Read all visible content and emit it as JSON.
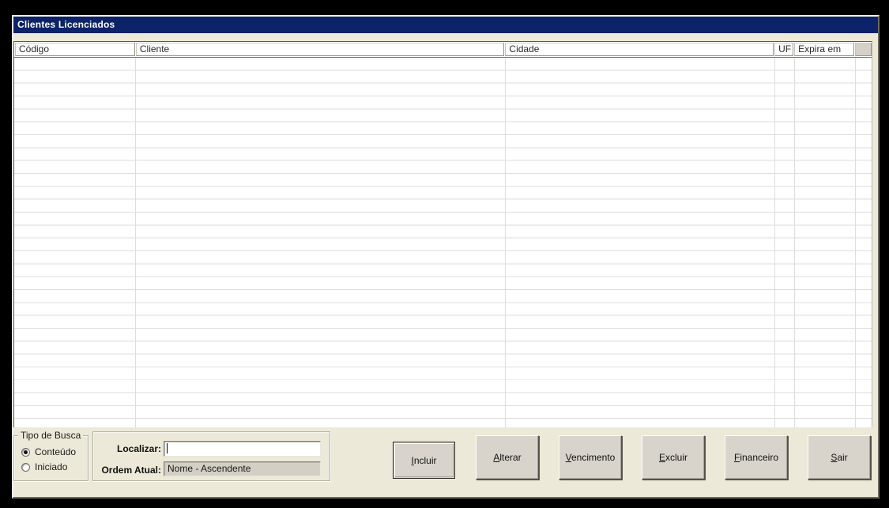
{
  "window": {
    "title": "Clientes Licenciados"
  },
  "colors": {
    "title_bar": "#0C2369",
    "window_background": "#ECE9D8",
    "button_face": "#D8D4CB",
    "grid_line": "#DEDEDC"
  },
  "table": {
    "columns": [
      "Código",
      "Cliente",
      "Cidade",
      "UF",
      "Expira em",
      ""
    ],
    "rows": []
  },
  "tipo_busca": {
    "title": "Tipo de Busca",
    "options": [
      {
        "label": "Conteúdo",
        "selected": true
      },
      {
        "label": "Iniciado",
        "selected": false
      }
    ]
  },
  "search": {
    "localizar_label": "Localizar:",
    "localizar_value": "",
    "ordem_label": "Ordem Atual:",
    "ordem_value": "Nome - Ascendente"
  },
  "buttons": [
    {
      "u": "I",
      "rest": "ncluir",
      "label": "Incluir"
    },
    {
      "u": "A",
      "rest": "lterar",
      "label": "Alterar"
    },
    {
      "u": "V",
      "rest": "encimento",
      "label": "Vencimento"
    },
    {
      "u": "E",
      "rest": "xcluir",
      "label": "Excluir"
    },
    {
      "u": "F",
      "rest": "inanceiro",
      "label": "Financeiro"
    },
    {
      "u": "S",
      "rest": "air",
      "label": "Sair"
    }
  ]
}
